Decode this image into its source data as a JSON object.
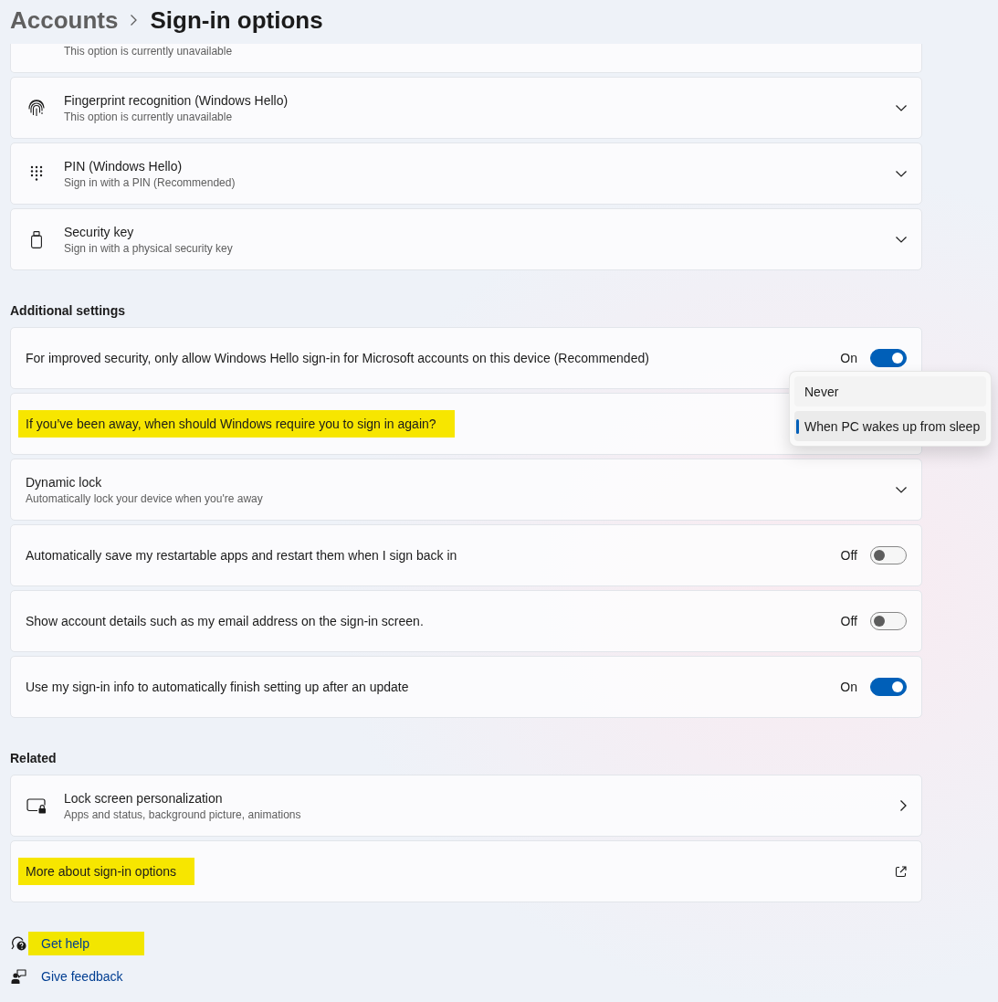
{
  "header": {
    "breadcrumb": [
      {
        "label": "Accounts",
        "current": false
      },
      {
        "label": "Sign-in options",
        "current": true
      }
    ]
  },
  "sign_in_methods": [
    {
      "kind": "partial",
      "subtitle": "This option is currently unavailable"
    },
    {
      "kind": "expander",
      "title": "Fingerprint recognition (Windows Hello)",
      "subtitle": "This option is currently unavailable"
    },
    {
      "kind": "expander",
      "title": "PIN (Windows Hello)",
      "subtitle": "Sign in with a PIN (Recommended)"
    },
    {
      "kind": "expander",
      "title": "Security key",
      "subtitle": "Sign in with a physical security key"
    }
  ],
  "additional_settings": {
    "heading": "Additional settings",
    "items": [
      {
        "kind": "toggle",
        "title": "For improved security, only allow Windows Hello sign-in for Microsoft accounts on this device (Recommended)",
        "highlighted": false,
        "state_label": "On",
        "on": true
      },
      {
        "kind": "dropdown",
        "title": "If you’ve been away, when should Windows require you to sign in again?",
        "highlighted": true,
        "menu": [
          {
            "label": "Never",
            "selected": false
          },
          {
            "label": "When PC wakes up from sleep",
            "selected": true
          }
        ]
      },
      {
        "kind": "expander",
        "title": "Dynamic lock",
        "subtitle": "Automatically lock your device when you're away",
        "highlighted": false
      },
      {
        "kind": "toggle",
        "title": "Automatically save my restartable apps and restart them when I sign back in",
        "highlighted": false,
        "state_label": "Off",
        "on": false
      },
      {
        "kind": "toggle",
        "title": "Show account details such as my email address on the sign-in screen.",
        "highlighted": false,
        "state_label": "Off",
        "on": false
      },
      {
        "kind": "toggle",
        "title": "Use my sign-in info to automatically finish setting up after an update",
        "highlighted": false,
        "state_label": "On",
        "on": true
      }
    ]
  },
  "related": {
    "heading": "Related",
    "items": [
      {
        "kind": "link",
        "title": "Lock screen personalization",
        "subtitle": "Apps and status, background picture, animations",
        "highlighted": false
      },
      {
        "kind": "external",
        "title": "More about sign-in options",
        "highlighted": true
      }
    ]
  },
  "footer_links": [
    {
      "label": "Get help",
      "highlighted": true
    },
    {
      "label": "Give feedback",
      "highlighted": false
    }
  ]
}
